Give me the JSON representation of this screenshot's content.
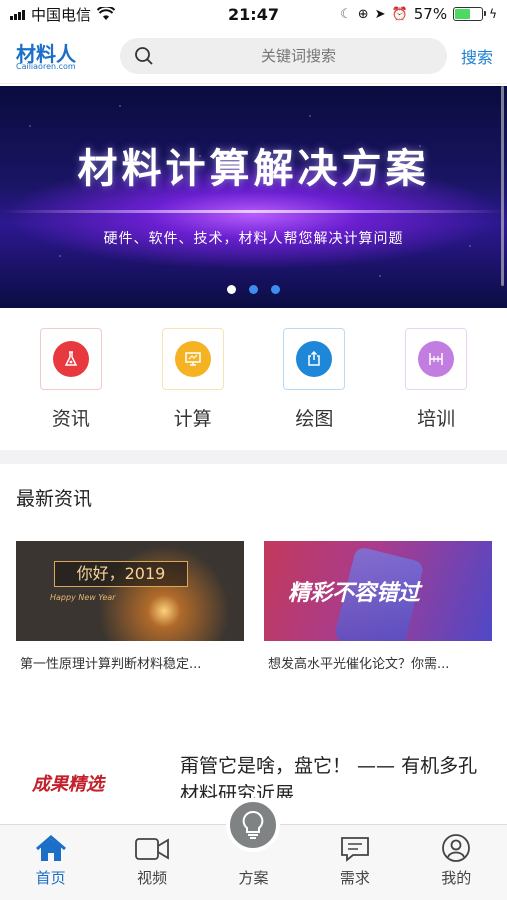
{
  "status_bar": {
    "carrier": "中国电信",
    "time": "21:47",
    "battery_percent": "57%",
    "battery_level": 0.57
  },
  "header": {
    "logo_text": "材料人",
    "logo_sub": "Cailiaoren.com",
    "search_placeholder": "关键词搜索",
    "search_button": "搜索"
  },
  "banner": {
    "title": "材料计算解决方案",
    "subtitle": "硬件、软件、技术，材料人帮您解决计算问题",
    "slide_count": 3,
    "active_slide": 0
  },
  "categories": [
    {
      "label": "资讯",
      "icon": "flask-icon",
      "color": "#e8393e",
      "border": "#f6c9c9"
    },
    {
      "label": "计算",
      "icon": "monitor-icon",
      "color": "#f5b323",
      "border": "#f8e3b4"
    },
    {
      "label": "绘图",
      "icon": "export-icon",
      "color": "#1f87d8",
      "border": "#bcd9f3"
    },
    {
      "label": "培训",
      "icon": "board-icon",
      "color": "#c17de0",
      "border": "#ead4f4"
    }
  ],
  "news": {
    "section_title": "最新资讯",
    "cards": [
      {
        "image_text": "你好，2019",
        "image_sub": "Happy New Year",
        "caption": "第一性原理计算判断材料稳定..."
      },
      {
        "image_text": "精彩不容错过",
        "caption": "想发高水平光催化论文？你需..."
      }
    ],
    "article": {
      "thumb_text": "成果精选",
      "title": "甭管它是啥，盘它！ —— 有机多孔材料研究近展"
    }
  },
  "tabbar": {
    "items": [
      {
        "label": "首页",
        "icon": "home-icon",
        "active": true
      },
      {
        "label": "视频",
        "icon": "video-icon",
        "active": false
      },
      {
        "label": "方案",
        "icon": "lightbulb-icon",
        "active": false
      },
      {
        "label": "需求",
        "icon": "chat-icon",
        "active": false
      },
      {
        "label": "我的",
        "icon": "user-icon",
        "active": false
      }
    ],
    "active_color": "#1c6fc7"
  }
}
